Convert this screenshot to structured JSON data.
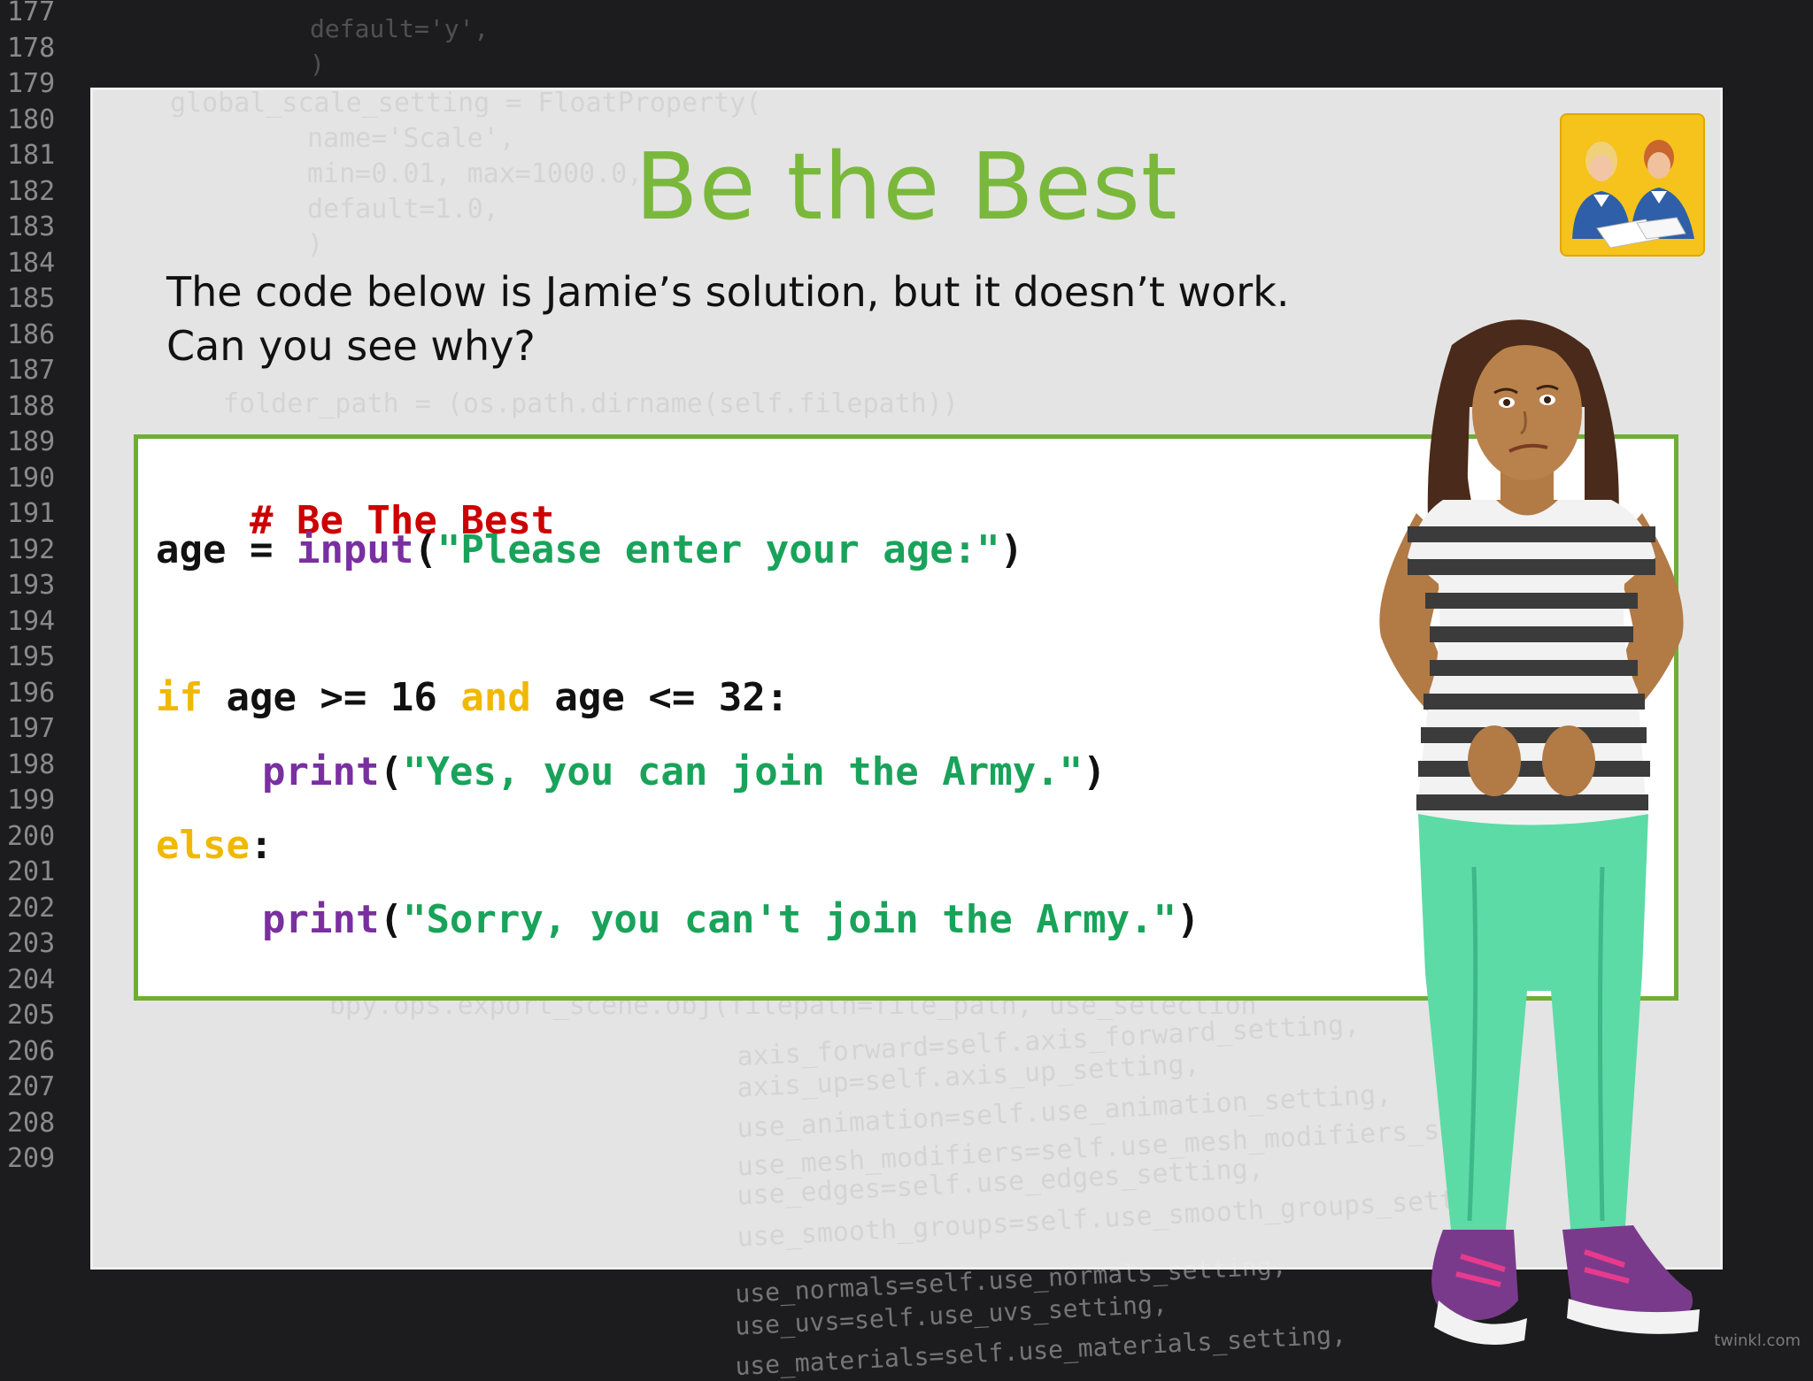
{
  "background": {
    "line_numbers": [
      "177",
      "178",
      "179",
      "180",
      "181",
      "182",
      "183",
      "184",
      "185",
      "186",
      "187",
      "188",
      "189",
      "190",
      "191",
      "192",
      "193",
      "194",
      "195",
      "196",
      "197",
      "198",
      "199",
      "200",
      "201",
      "202",
      "203",
      "204",
      "205",
      "206",
      "207",
      "208",
      "209"
    ],
    "snippets": [
      "default='y',",
      ")",
      "axis_forward=self.axis_forward_setting,",
      "axis_up=self.axis_up_setting,",
      "use_animation=self.use_animation_setting,",
      "use_mesh_modifiers=self.use_mesh_modifiers_setti",
      "use_edges=self.use_edges_setting,",
      "use_smooth_groups=self.use_smooth_groups_setting",
      "use_normals=self.use_normals_setting,",
      "use_uvs=self.use_uvs_setting,",
      "use_materials=self.use_materials_setting,"
    ],
    "slide_ghosts": [
      "global_scale_setting = FloatProperty(",
      "name='Scale',",
      "min=0.01, max=1000.0,",
      "default=1.0,",
      ")",
      "folder_path = (os.path.dirname(self.filepath))",
      "bpy.ops.export_scene.obj(filepath=file_path, use_selection"
    ]
  },
  "slide": {
    "title": "Be the Best",
    "intro_line_1": "The code below is Jamie’s solution, but it doesn’t work.",
    "intro_line_2": "Can you see why?"
  },
  "code": {
    "comment": "# Be The Best",
    "line2_var": "age = ",
    "line2_func": "input",
    "line2_open": "(",
    "line2_str": "\"Please enter your age:\"",
    "line2_close": ")",
    "line3_kw1": "if",
    "line3_mid1": " age >= 16 ",
    "line3_kw2": "and",
    "line3_mid2": " age <= 32:",
    "line4_func": "print",
    "line4_open": "(",
    "line4_str": "\"Yes, you can join the Army.\"",
    "line4_close": ")",
    "line5_kw": "else",
    "line5_colon": ":",
    "line6_func": "print",
    "line6_open": "(",
    "line6_str": "\"Sorry, you can't join the Army.\"",
    "line6_close": ")"
  },
  "watermark": "twinkl.com",
  "colors": {
    "title_green": "#7ab83b",
    "border_green": "#6fae36",
    "comment_red": "#cc0000",
    "function_purple": "#7a2fa0",
    "string_green": "#19a35a",
    "keyword_yellow": "#f0b800"
  },
  "icons": [
    "students-reading-icon",
    "girl-character-illustration"
  ]
}
